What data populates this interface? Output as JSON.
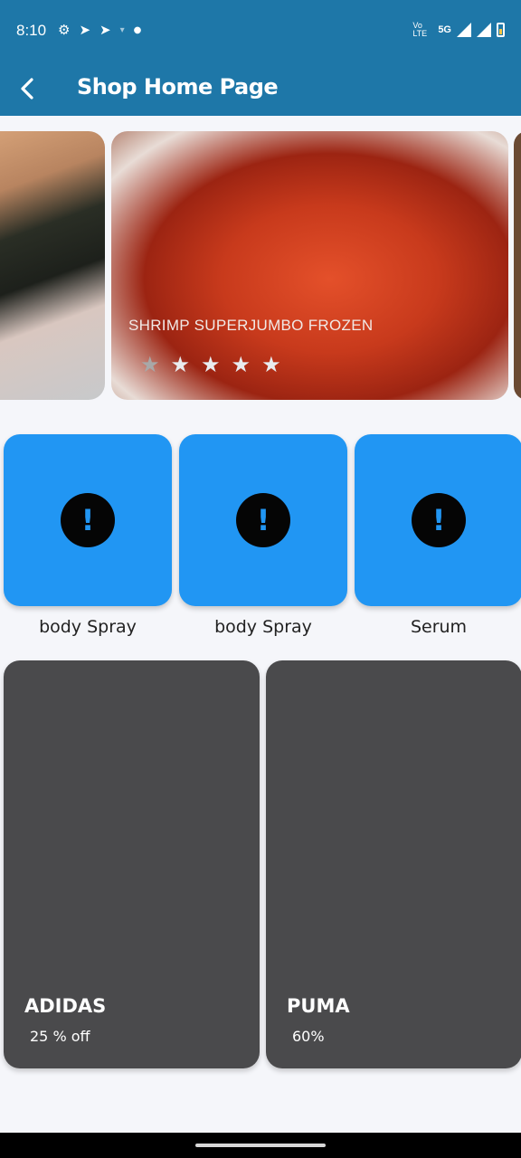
{
  "status": {
    "time": "8:10",
    "left_icons": [
      "gear-icon",
      "telegram-icon",
      "telegram-icon",
      "wifi-small-icon",
      "dot-icon"
    ],
    "network_label": "Vo LTE",
    "network_type": "5G"
  },
  "app_bar": {
    "title": "Shop Home Page",
    "color": "#1e77a8"
  },
  "carousel": {
    "caption": "SHRIMP SUPERJUMBO FROZEN",
    "rating": 4,
    "max_rating": 5
  },
  "categories": [
    {
      "label": "body Spray",
      "icon": "error-icon"
    },
    {
      "label": "body Spray",
      "icon": "error-icon"
    },
    {
      "label": "Serum",
      "icon": "error-icon"
    }
  ],
  "brands": [
    {
      "name": "ADIDAS",
      "discount": "25 % off"
    },
    {
      "name": "PUMA",
      "discount": "60%"
    }
  ],
  "colors": {
    "tile": "#2196f3",
    "brand_card": "#4a4a4c"
  }
}
